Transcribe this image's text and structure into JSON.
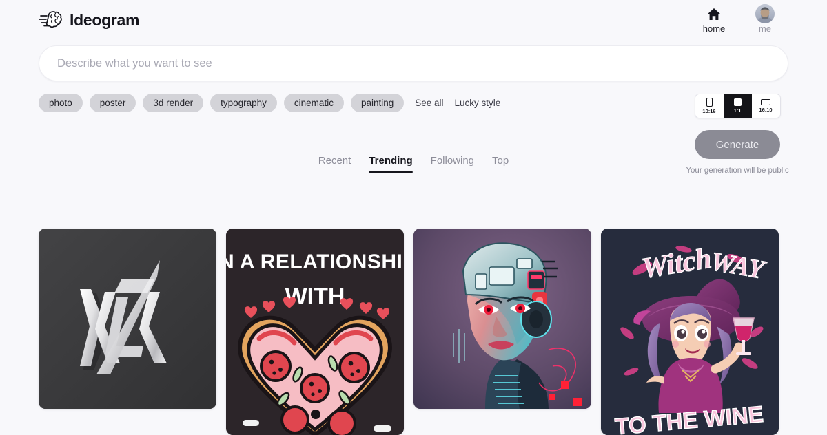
{
  "brand": {
    "name": "Ideogram",
    "logo_icon": "brain-icon"
  },
  "header": {
    "nav": [
      {
        "label": "home",
        "icon": "home-icon"
      },
      {
        "label": "me",
        "icon": "avatar-icon"
      }
    ]
  },
  "prompt": {
    "placeholder": "Describe what you want to see",
    "value": ""
  },
  "style_chips": [
    {
      "label": "photo"
    },
    {
      "label": "poster"
    },
    {
      "label": "3d render"
    },
    {
      "label": "typography"
    },
    {
      "label": "cinematic"
    },
    {
      "label": "painting"
    }
  ],
  "links": [
    {
      "label": "See all"
    },
    {
      "label": "Lucky style"
    }
  ],
  "aspect_ratio": {
    "options": [
      {
        "label": "10:16",
        "shape": "portrait",
        "selected": false
      },
      {
        "label": "1:1",
        "shape": "square",
        "selected": true
      },
      {
        "label": "16:10",
        "shape": "landscape",
        "selected": false
      }
    ]
  },
  "generate": {
    "label": "Generate",
    "disabled": true,
    "note": "Your generation will be public"
  },
  "tabs": [
    {
      "label": "Recent",
      "active": false
    },
    {
      "label": "Trending",
      "active": true
    },
    {
      "label": "Following",
      "active": false
    },
    {
      "label": "Top",
      "active": false
    }
  ],
  "gallery": [
    {
      "alt": "Metallic silver KLK monogram logo on dark charcoal background",
      "background": "#3a3a3c",
      "text": "KLK"
    },
    {
      "alt": "Hand lettered poster: IN A RELATIONSHIP WITH heart shaped pepperoni pizza",
      "background": "#2a2528",
      "line1": "IN A RELATIONSHIP",
      "line2": "WITH"
    },
    {
      "alt": "Cyberpunk female android portrait with neon teal and magenta lighting",
      "background": "#6b5270"
    },
    {
      "alt": "Cartoon witch holding wine glass with pink lettering",
      "background": "#252b3b",
      "line1": "Witch Way",
      "line2": "TO THE WINE"
    }
  ]
}
